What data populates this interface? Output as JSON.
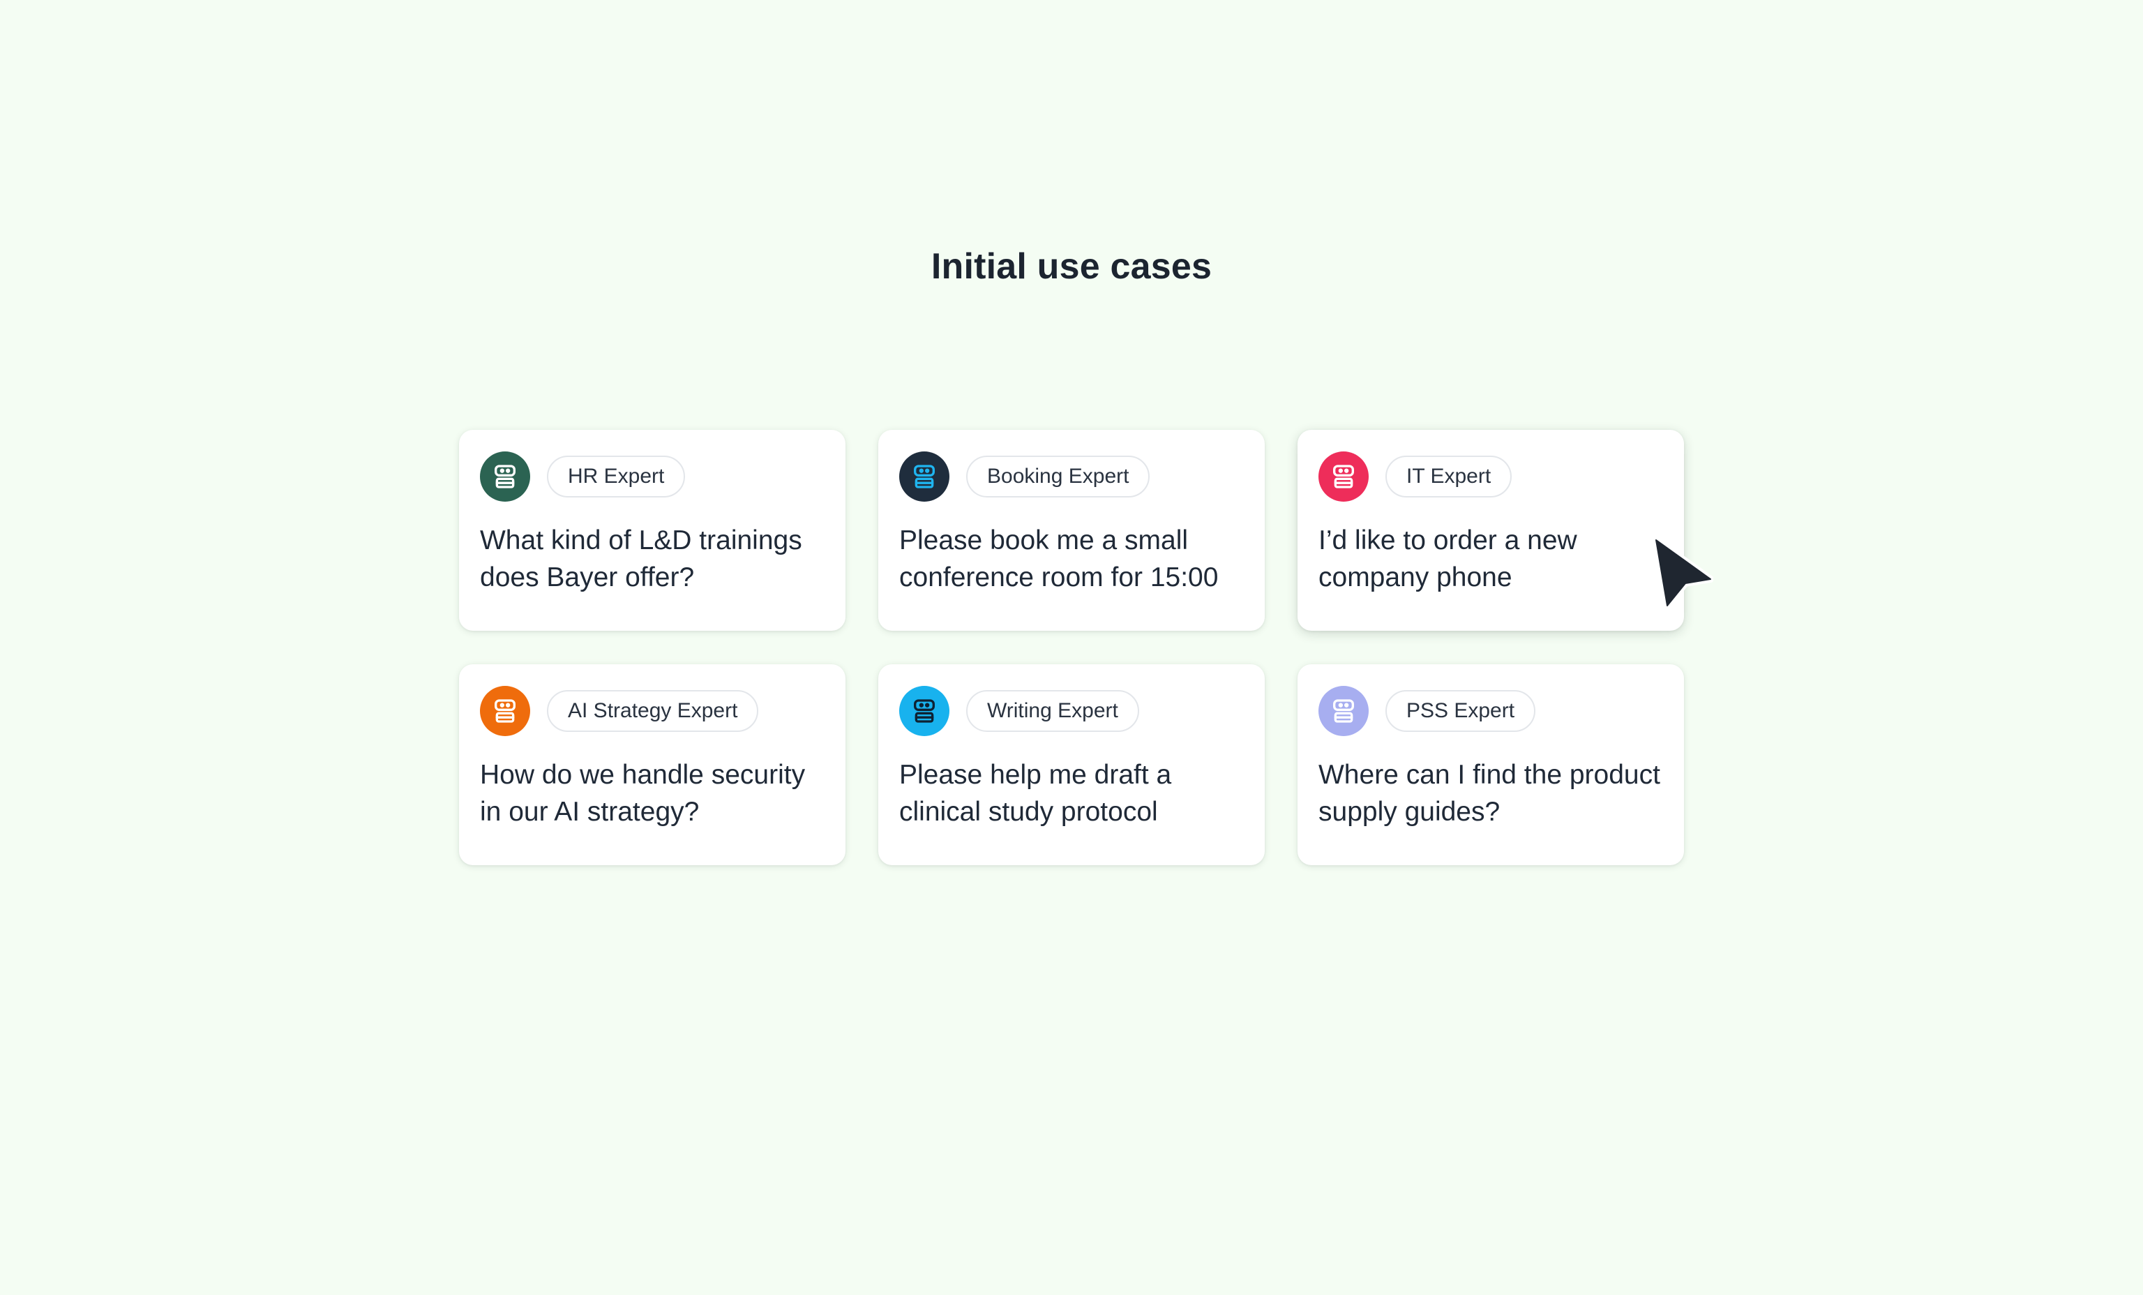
{
  "page": {
    "title": "Initial use cases"
  },
  "cards": [
    {
      "expert": "HR Expert",
      "prompt": "What kind of L&D trainings does Bayer offer?",
      "avatar_color": "#2b6352",
      "icon_color": "#ffffff",
      "icon": "robot-icon"
    },
    {
      "expert": "Booking Expert",
      "prompt": "Please book me a small conference room for 15:00",
      "avatar_color": "#1f2d3d",
      "icon_color": "#1fb5f0",
      "icon": "robot-icon"
    },
    {
      "expert": "IT Expert",
      "prompt": "I’d like to order a new company phone",
      "avatar_color": "#ee2d5a",
      "icon_color": "#ffffff",
      "icon": "robot-icon"
    },
    {
      "expert": "AI Strategy Expert",
      "prompt": "How do we handle security in our AI strategy?",
      "avatar_color": "#ef6c0c",
      "icon_color": "#ffffff",
      "icon": "robot-icon"
    },
    {
      "expert": "Writing Expert",
      "prompt": "Please help me draft a clinical study protocol",
      "avatar_color": "#18b2ee",
      "icon_color": "#0e2233",
      "icon": "robot-icon"
    },
    {
      "expert": "PSS Expert",
      "prompt": "Where can I find the product supply guides?",
      "avatar_color": "#a7aef0",
      "icon_color": "#ffffff",
      "icon": "robot-icon"
    }
  ],
  "cursor": {
    "icon": "mouse-pointer-icon",
    "color": "#1f2630"
  }
}
